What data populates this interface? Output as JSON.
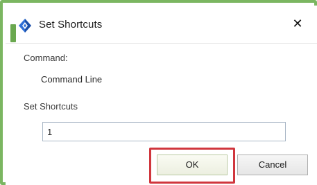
{
  "dialog": {
    "title": "Set Shortcuts",
    "icon": "app-logo-icon",
    "close_glyph": "✕",
    "accent_color": "#6aa84f",
    "frame_color": "#7bb661"
  },
  "form": {
    "command_label": "Command:",
    "command_value": "Command Line",
    "shortcuts_label": "Set Shortcuts",
    "shortcut_value": "1",
    "shortcut_placeholder": ""
  },
  "buttons": {
    "ok_label": "OK",
    "cancel_label": "Cancel",
    "highlight_color": "#d0363d"
  }
}
